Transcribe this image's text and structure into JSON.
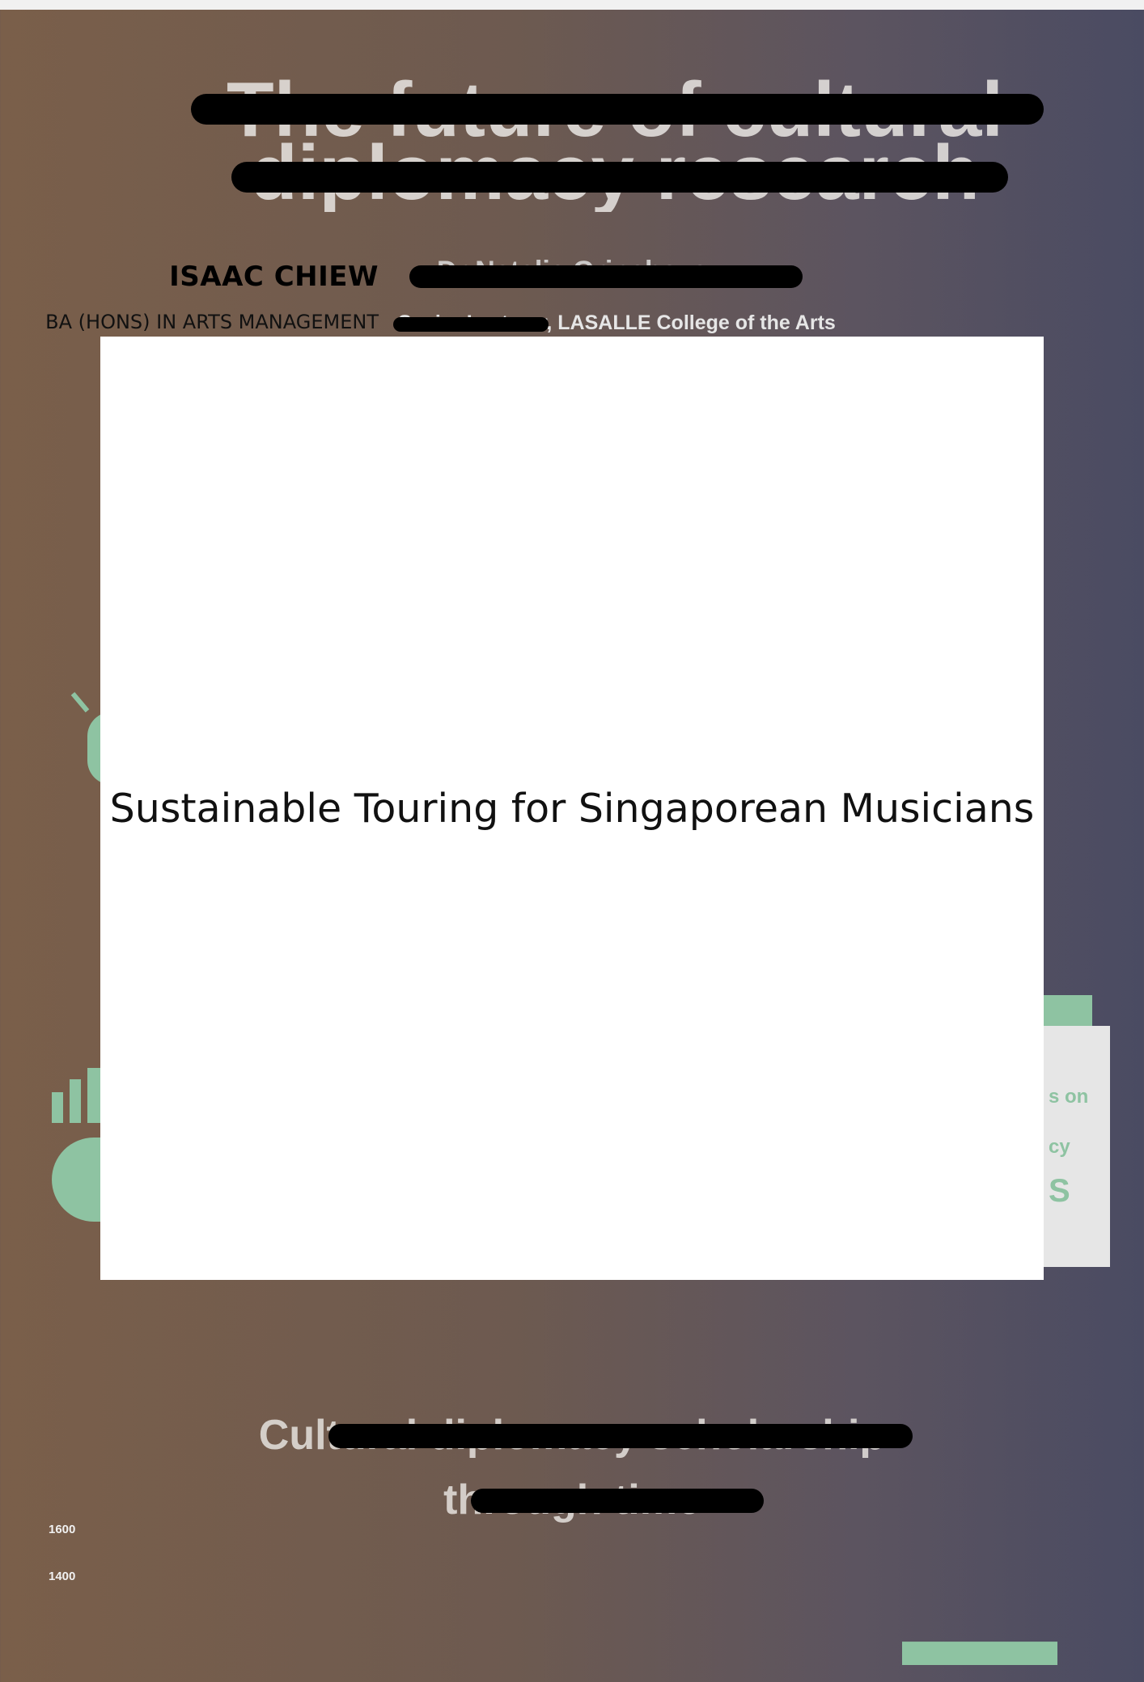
{
  "header": {
    "title_line1": "The future of cultural",
    "title_line2": "diplomacy research"
  },
  "author": {
    "name": "ISAAC CHIEW",
    "degree": "BA (HONS) IN ARTS MANAGEMENT"
  },
  "supervisor": {
    "name": "Dr Natalia Grincheva",
    "affiliation": "Senior Lecturer, LASALLE College of the Arts"
  },
  "cover": {
    "title": "Sustainable Touring for Singaporean Musicians"
  },
  "side_panel": {
    "line1": "s on",
    "line2": "cy",
    "line3": "S"
  },
  "bottom": {
    "line1": "Cultural diplomacy scholarship",
    "line2": "through time"
  },
  "axis_ticks": [
    "1600",
    "1400"
  ],
  "colors": {
    "accent_mint": "#8ec3a2",
    "redaction": "#000000",
    "cover_background": "#ffffff"
  }
}
